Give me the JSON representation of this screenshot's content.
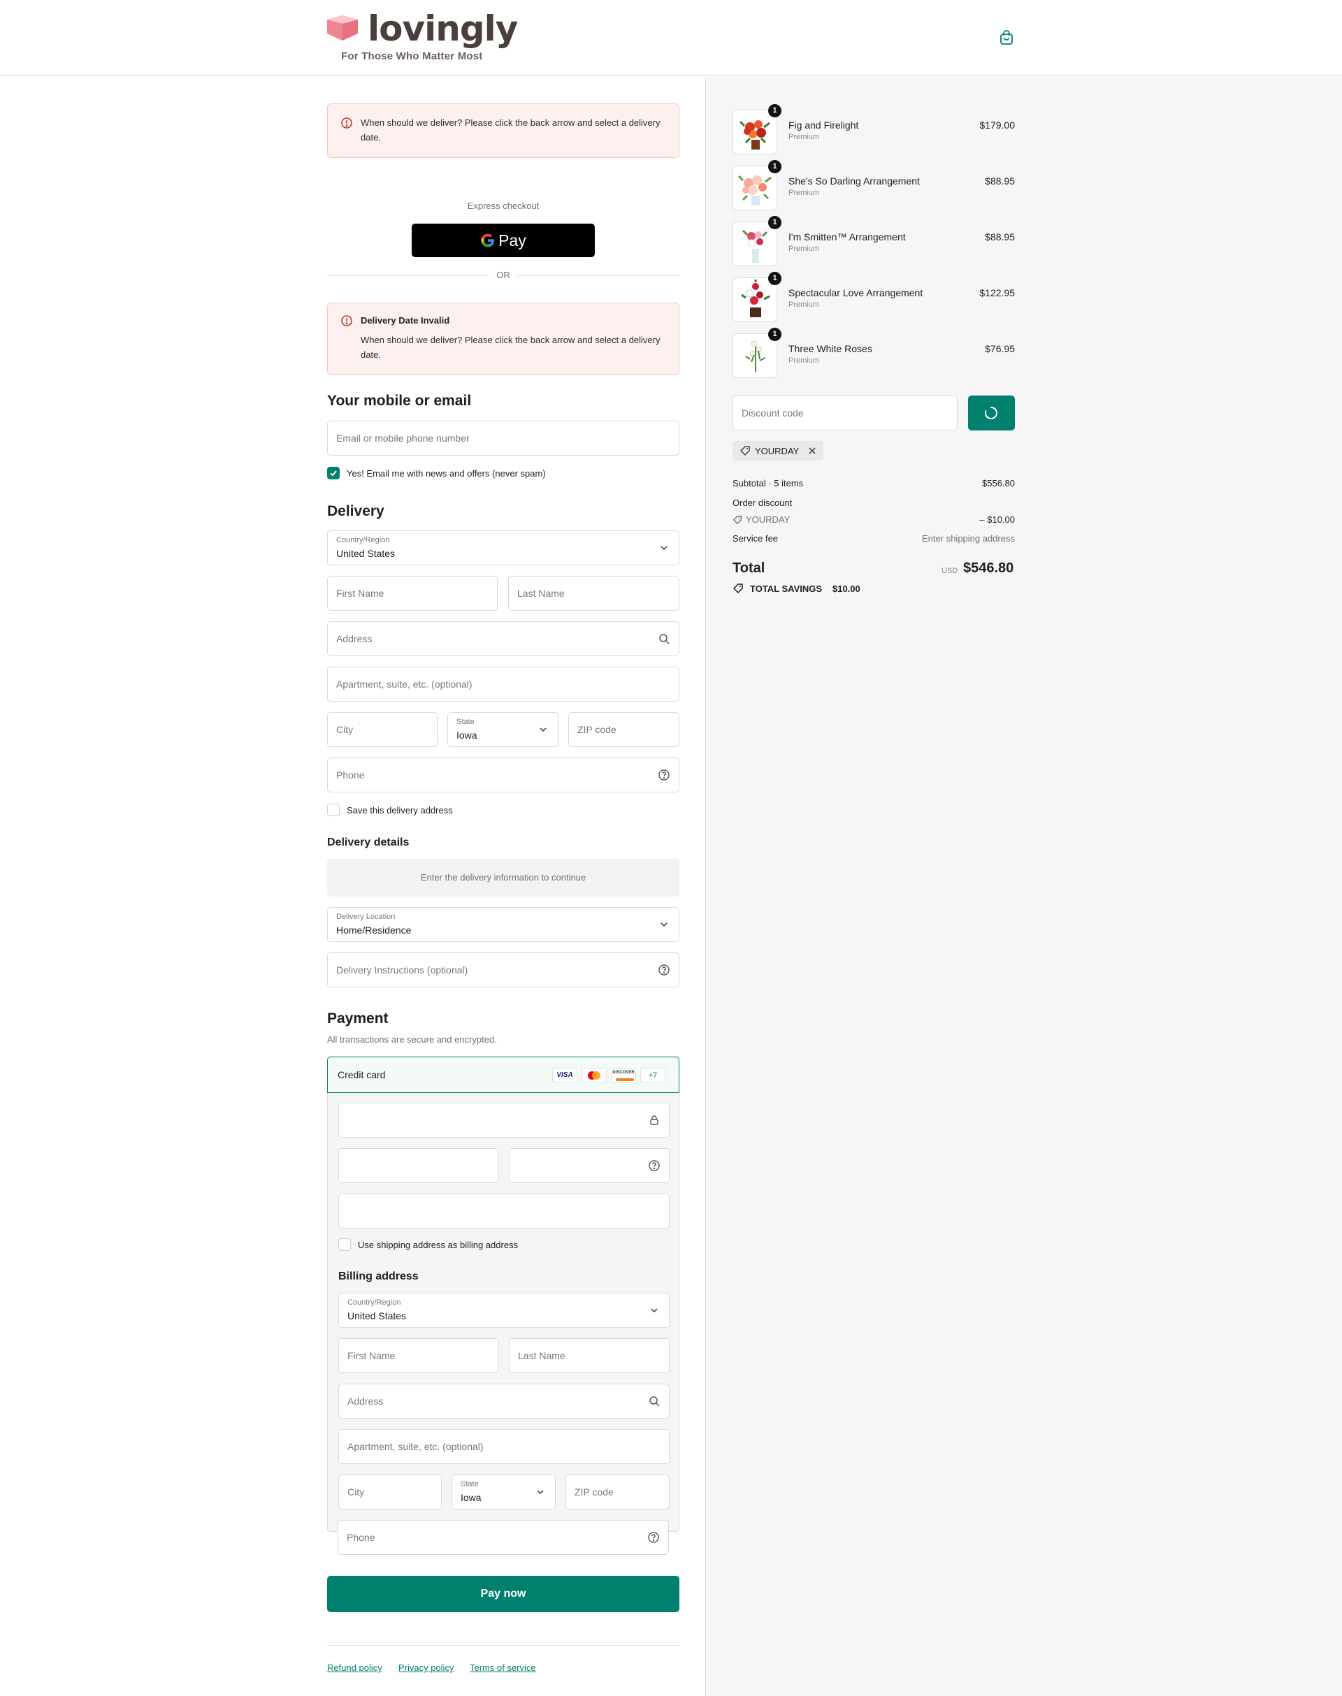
{
  "header": {
    "brand": "lovingly",
    "tagline": "For Those Who Matter Most",
    "cart_icon": "shopping-bag-icon"
  },
  "alerts": {
    "top_text": "When should we deliver? Please click the back arrow and select a delivery date.",
    "second_title": "Delivery Date Invalid",
    "second_text": "When should we deliver? Please click the back arrow and select a delivery date."
  },
  "express": {
    "label": "Express checkout",
    "gpay_label": "Pay",
    "or": "OR"
  },
  "contact": {
    "heading": "Your mobile or email",
    "email_placeholder": "Email or mobile phone number",
    "news_label": "Yes! Email me with news and offers (never spam)",
    "news_checked": true
  },
  "delivery": {
    "heading": "Delivery",
    "country_label": "Country/Region",
    "country_value": "United States",
    "first_name": "First Name",
    "last_name": "Last Name",
    "address": "Address",
    "apartment": "Apartment, suite, etc. (optional)",
    "city": "City",
    "state_label": "State",
    "state_value": "Iowa",
    "zip": "ZIP code",
    "phone": "Phone",
    "save_label": "Save this delivery address"
  },
  "delivery_details": {
    "heading": "Delivery details",
    "info": "Enter the delivery information to continue",
    "location_label": "Delivery Location",
    "location_value": "Home/Residence",
    "instructions": "Delivery Instructions (optional)"
  },
  "payment": {
    "heading": "Payment",
    "subtitle": "All transactions are secure and encrypted.",
    "method": "Credit card",
    "cards": [
      "VISA",
      "DISCOVER"
    ],
    "more_cards": "+7",
    "use_shipping_label": "Use shipping address as billing address",
    "billing_heading": "Billing address",
    "billing": {
      "country_label": "Country/Region",
      "country_value": "United States",
      "first_name": "First Name",
      "last_name": "Last Name",
      "address": "Address",
      "apartment": "Apartment, suite, etc. (optional)",
      "city": "City",
      "state_label": "State",
      "state_value": "Iowa",
      "zip": "ZIP code",
      "phone": "Phone"
    },
    "pay_button": "Pay now"
  },
  "footer": {
    "links": [
      "Refund policy",
      "Privacy policy",
      "Terms of service"
    ]
  },
  "order": {
    "items": [
      {
        "name": "Fig and Firelight",
        "variant": "Premium",
        "price": "$179.00",
        "qty": "1"
      },
      {
        "name": "She's So Darling Arrangement",
        "variant": "Premium",
        "price": "$88.95",
        "qty": "1"
      },
      {
        "name": "I'm Smitten™ Arrangement",
        "variant": "Premium",
        "price": "$88.95",
        "qty": "1"
      },
      {
        "name": "Spectacular Love Arrangement",
        "variant": "Premium",
        "price": "$122.95",
        "qty": "1"
      },
      {
        "name": "Three White Roses",
        "variant": "Premium",
        "price": "$76.95",
        "qty": "1"
      }
    ],
    "discount_placeholder": "Discount code",
    "applied_code": "YOURDAY",
    "subtotal_label": "Subtotal · 5 items",
    "subtotal_value": "$556.80",
    "order_discount_label": "Order discount",
    "discount_code": "YOURDAY",
    "discount_value": "– $10.00",
    "service_fee_label": "Service fee",
    "service_fee_value": "Enter shipping address",
    "total_label": "Total",
    "currency": "USD",
    "total_value": "$546.80",
    "savings_label": "TOTAL SAVINGS",
    "savings_value": "$10.00"
  },
  "colors": {
    "accent": "#00806e",
    "alert_bg": "#fdf1f0",
    "alert_border": "#f4c7c3",
    "error_icon": "#c0392b",
    "brand_pink": "#e8717f"
  }
}
